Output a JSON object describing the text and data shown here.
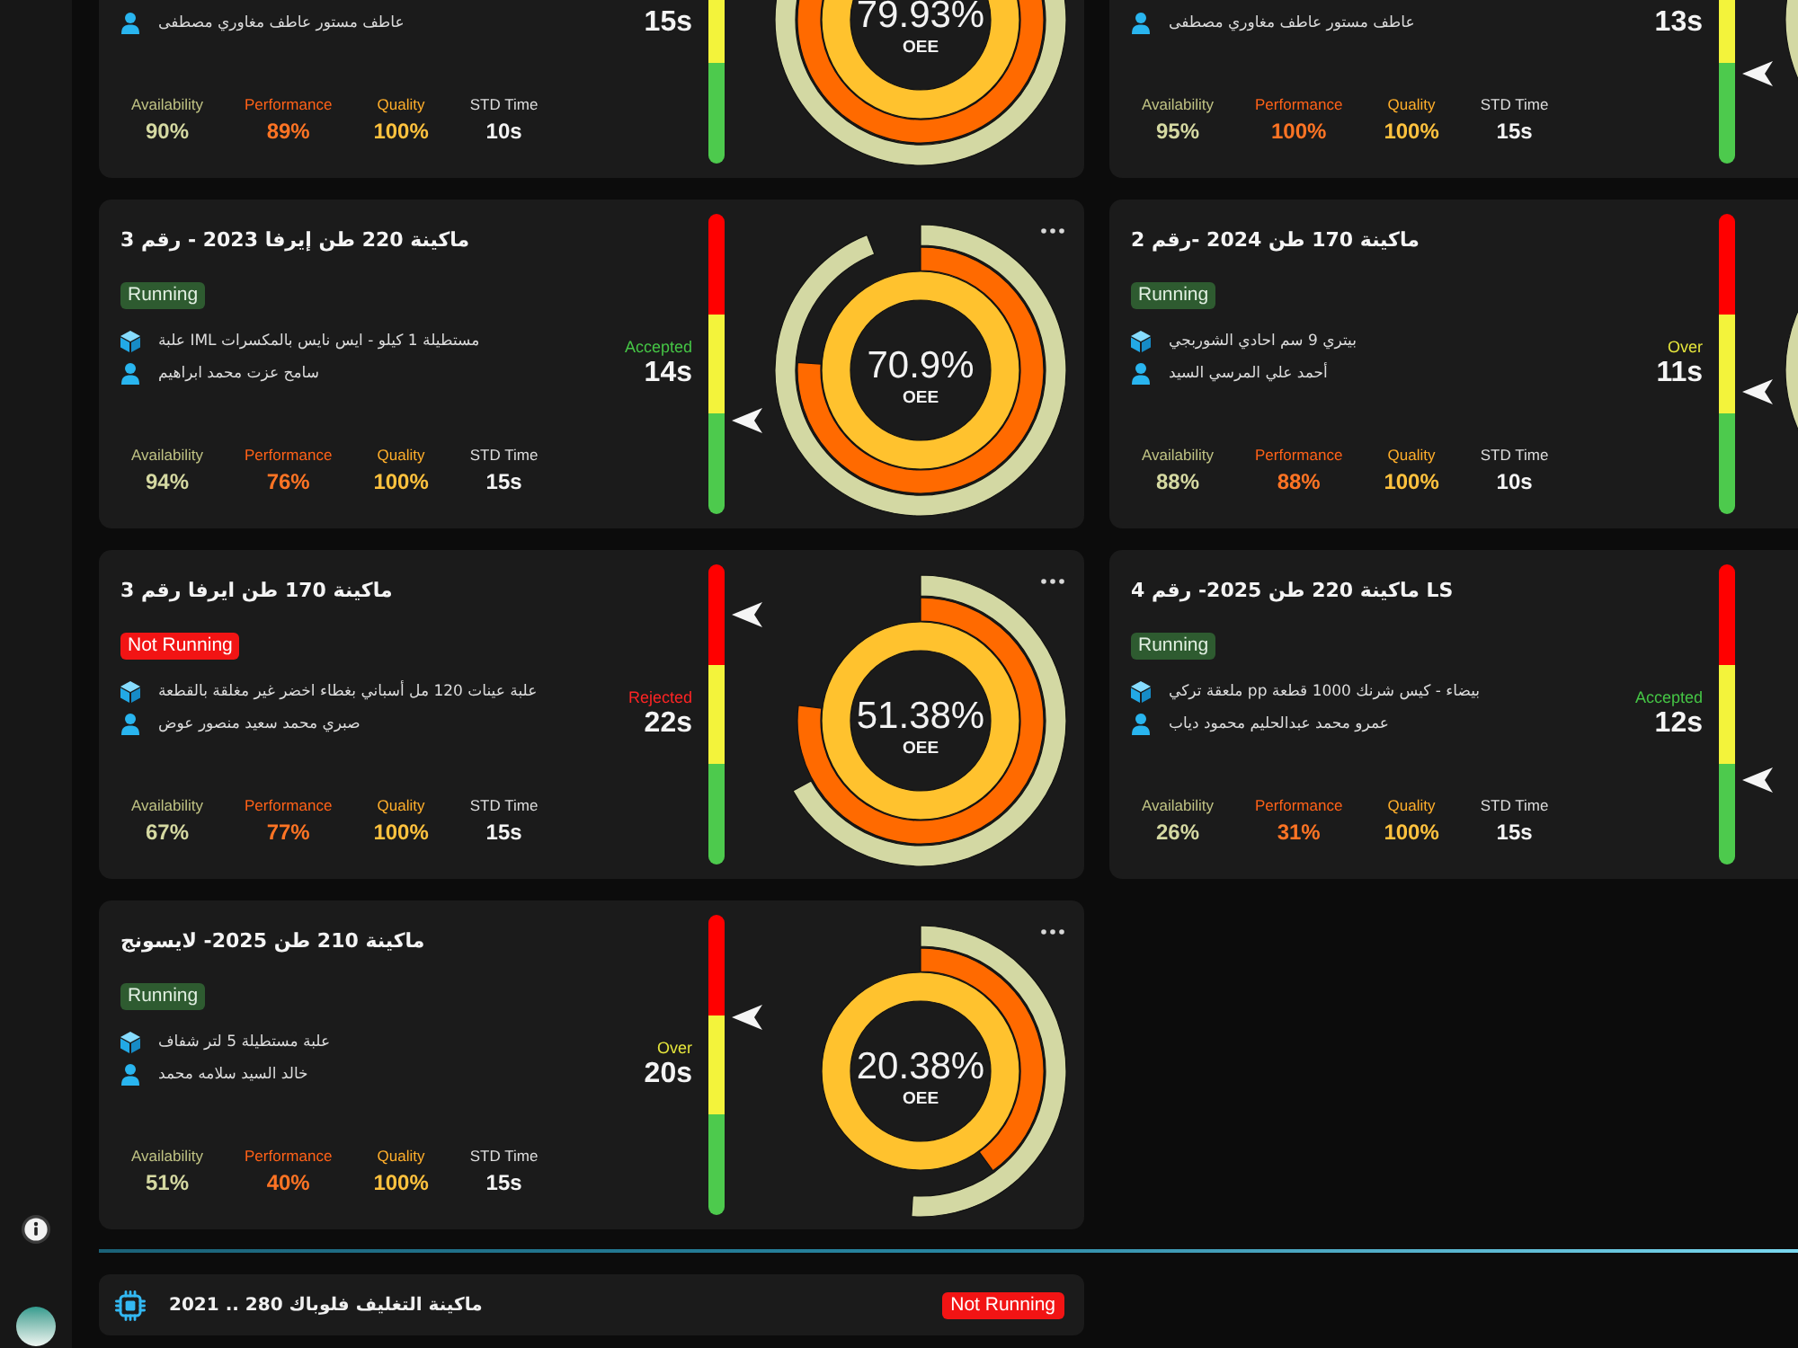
{
  "columns": [
    {
      "cards": [
        {
          "operator": "عاطف مستور عاطف مغاوري مصطفى",
          "cycle": {
            "value": "15s"
          },
          "donut": {
            "value": "79.93%",
            "label": "OEE",
            "rings": [
              {
                "kind": "availability"
              },
              {
                "kind": "performance"
              },
              {
                "kind": "quality"
              }
            ]
          },
          "metrics": [
            {
              "kind": "availability",
              "label": "Availability",
              "value": "90%"
            },
            {
              "kind": "performance",
              "label": "Performance",
              "value": "89%"
            },
            {
              "kind": "quality",
              "label": "Quality",
              "value": "100%"
            },
            {
              "kind": "std_time",
              "label": "STD Time",
              "value": "10s"
            }
          ]
        },
        {
          "title": "ماكينة 220 طن إيرفا 2023 - رقم 3",
          "status": {
            "kind": "running",
            "label": "Running"
          },
          "product": "علبة IML مستطيلة 1 كيلو - ايس نايس بالمكسرات",
          "operator": "سامح عزت محمد ابراهيم",
          "cycle": {
            "kind": "accepted",
            "label": "Accepted",
            "value": "14s"
          },
          "gauge": {
            "level": 0.31
          },
          "donut": {
            "value": "70.9%",
            "label": "OEE",
            "rings": [
              {
                "kind": "availability"
              },
              {
                "kind": "performance"
              },
              {
                "kind": "quality"
              }
            ]
          },
          "metrics": [
            {
              "kind": "availability",
              "label": "Availability",
              "value": "94%"
            },
            {
              "kind": "performance",
              "label": "Performance",
              "value": "76%"
            },
            {
              "kind": "quality",
              "label": "Quality",
              "value": "100%"
            },
            {
              "kind": "std_time",
              "label": "STD Time",
              "value": "15s"
            }
          ]
        },
        {
          "title": "ماكينة 170 طن ايرفا رقم 3",
          "status": {
            "kind": "stopped",
            "label": "Not Running"
          },
          "product": "علبة عينات 120 مل أسباني بغطاء اخضر غير مغلقة بالقطعة",
          "operator": "صبري محمد سعيد منصور عوض",
          "cycle": {
            "kind": "rejected",
            "label": "Rejected",
            "value": "22s"
          },
          "gauge": {
            "level": 0.83
          },
          "donut": {
            "value": "51.38%",
            "label": "OEE",
            "rings": [
              {
                "kind": "availability"
              },
              {
                "kind": "performance"
              },
              {
                "kind": "quality"
              }
            ]
          },
          "metrics": [
            {
              "kind": "availability",
              "label": "Availability",
              "value": "67%"
            },
            {
              "kind": "performance",
              "label": "Performance",
              "value": "77%"
            },
            {
              "kind": "quality",
              "label": "Quality",
              "value": "100%"
            },
            {
              "kind": "std_time",
              "label": "STD Time",
              "value": "15s"
            }
          ]
        },
        {
          "title": "ماكينة 210 طن 2025- لايسونج",
          "status": {
            "kind": "running",
            "label": "Running"
          },
          "product": "علبة مستطيلة 5 لتر شفاف",
          "operator": "خالد السيد سلامه محمد",
          "cycle": {
            "kind": "over",
            "label": "Over",
            "value": "20s"
          },
          "gauge": {
            "level": 0.66
          },
          "donut": {
            "value": "20.38%",
            "label": "OEE",
            "rings": [
              {
                "kind": "availability"
              },
              {
                "kind": "performance"
              },
              {
                "kind": "quality"
              }
            ]
          },
          "metrics": [
            {
              "kind": "availability",
              "label": "Availability",
              "value": "51%"
            },
            {
              "kind": "performance",
              "label": "Performance",
              "value": "40%"
            },
            {
              "kind": "quality",
              "label": "Quality",
              "value": "100%"
            },
            {
              "kind": "std_time",
              "label": "STD Time",
              "value": "15s"
            }
          ]
        }
      ]
    },
    {
      "cards": [
        {
          "operator": "عاطف مستور عاطف مغاوري مصطفى",
          "cycle": {
            "value": "13s"
          },
          "gauge": {
            "level": 0.3
          },
          "donut": {
            "rings": [
              {
                "kind": "availability"
              }
            ]
          },
          "metrics": [
            {
              "kind": "availability",
              "label": "Availability",
              "value": "95%"
            },
            {
              "kind": "performance",
              "label": "Performance",
              "value": "100%"
            },
            {
              "kind": "quality",
              "label": "Quality",
              "value": "100%"
            },
            {
              "kind": "std_time",
              "label": "STD Time",
              "value": "15s"
            }
          ]
        },
        {
          "title": "ماكينة 170 طن 2024 -رقم 2",
          "status": {
            "kind": "running",
            "label": "Running"
          },
          "product": "بيتري 9 سم احادي الشوربجي",
          "operator": "أحمد علي المرسي السيد",
          "cycle": {
            "kind": "over",
            "label": "Over",
            "value": "11s"
          },
          "gauge": {
            "level": 0.41
          },
          "donut": {
            "rings": [
              {
                "kind": "availability"
              }
            ]
          },
          "metrics": [
            {
              "kind": "availability",
              "label": "Availability",
              "value": "88%"
            },
            {
              "kind": "performance",
              "label": "Performance",
              "value": "88%"
            },
            {
              "kind": "quality",
              "label": "Quality",
              "value": "100%"
            },
            {
              "kind": "std_time",
              "label": "STD Time",
              "value": "10s"
            }
          ]
        },
        {
          "title": "ماكينة 220 طن 2025- رقم 4 LS",
          "status": {
            "kind": "running",
            "label": "Running"
          },
          "product": "ملعقة تركي pp بيضاء - كيس شرنك 1000 قطعة",
          "operator": "عمرو محمد عبدالحليم محمود دياب",
          "cycle": {
            "kind": "accepted",
            "label": "Accepted",
            "value": "12s"
          },
          "gauge": {
            "level": 0.28
          },
          "metrics": [
            {
              "kind": "availability",
              "label": "Availability",
              "value": "26%"
            },
            {
              "kind": "performance",
              "label": "Performance",
              "value": "31%"
            },
            {
              "kind": "quality",
              "label": "Quality",
              "value": "100%"
            },
            {
              "kind": "std_time",
              "label": "STD Time",
              "value": "15s"
            }
          ]
        }
      ]
    }
  ],
  "packaging_machine": {
    "title": "ماكينة التغليف فلوباك 280 .. 2021",
    "status": {
      "kind": "stopped",
      "label": "Not Running"
    }
  }
}
